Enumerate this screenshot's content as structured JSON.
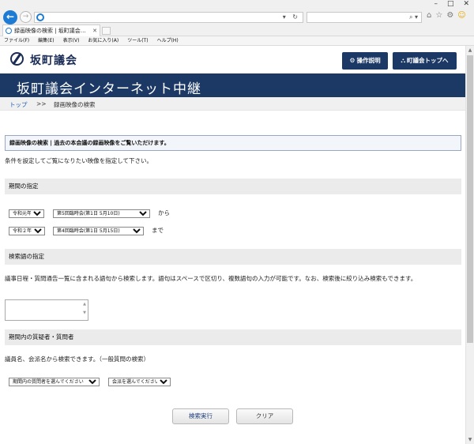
{
  "browser": {
    "window_controls": [
      "–",
      "□",
      "✕"
    ],
    "address_refresh": "▾ ↻",
    "search_icon": "⌕ ▾",
    "toolbar_icons": [
      "⌂",
      "☆",
      "⚙",
      "☺"
    ],
    "tab_title": "録画映像の検索 | 坂町議会…",
    "tab_close": "✕",
    "menu": [
      "ファイル(F)",
      "編集(E)",
      "表示(V)",
      "お気に入り(A)",
      "ツール(T)",
      "ヘルプ(H)"
    ]
  },
  "header": {
    "logo_text": "坂町議会",
    "help_button": "操作説明",
    "help_icon": "⚙",
    "top_button": "町議会トップへ",
    "top_icon": "⛬"
  },
  "banner": {
    "title": "坂町議会インターネット中継"
  },
  "breadcrumb": {
    "home": "トップ",
    "separator": ">>",
    "current": "録画映像の検索"
  },
  "notice": "録画映像の検索 | 過去の本会議の録画映像をご覧いただけます。",
  "intro": "条件を設定してご覧になりたい映像を指定して下さい。",
  "period": {
    "heading": "期間の指定",
    "from_year": "令和元年",
    "from_session": "第5回臨時会(第1日 5月10日)",
    "from_suffix": "から",
    "to_year": "令和２年",
    "to_session": "第4回臨時会(第1日 5月15日)",
    "to_suffix": "まで"
  },
  "keyword": {
    "heading": "検索語の指定",
    "description": "議事日程・質問通告一覧に含まれる語句から検索します。語句はスペースで区切り、複数語句の入力が可能です。なお、検索後に絞り込み検索もできます。",
    "value": ""
  },
  "speaker": {
    "heading": "期間内の質疑者・質問者",
    "description": "議員名、会派名から検索できます。（一般質問の検索）",
    "person_select": "期間内の質問者を選んでください",
    "party_select": "会派を選んでください"
  },
  "actions": {
    "search": "検索実行",
    "clear": "クリア"
  },
  "colors": {
    "navy": "#1c3966",
    "link": "#1a5fb0",
    "section_bg": "#ebebeb"
  }
}
